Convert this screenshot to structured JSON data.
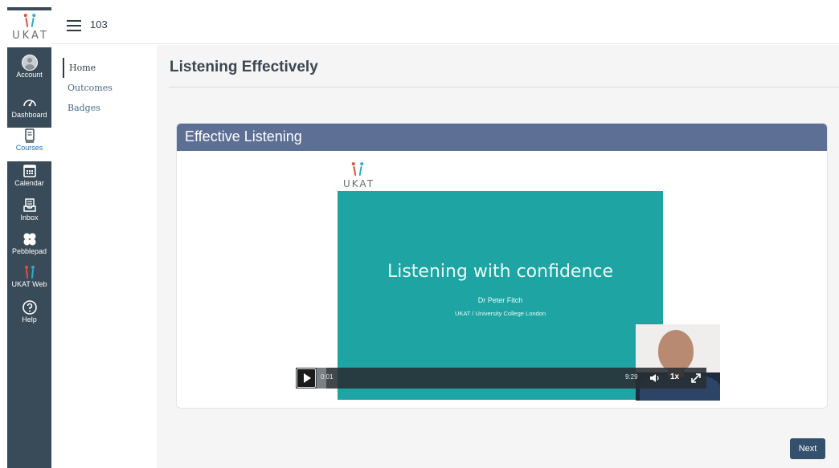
{
  "brand": {
    "logo_text": "UKAT"
  },
  "global_nav": {
    "items": [
      {
        "label": "Account",
        "icon": "avatar-icon"
      },
      {
        "label": "Dashboard",
        "icon": "dashboard-gauge-icon"
      },
      {
        "label": "Courses",
        "icon": "book-icon",
        "active": true
      },
      {
        "label": "Calendar",
        "icon": "calendar-icon"
      },
      {
        "label": "Inbox",
        "icon": "inbox-icon"
      },
      {
        "label": "Pebblepad",
        "icon": "pebblepad-icon"
      },
      {
        "label": "UKAT Web",
        "icon": "ukat-figures-icon"
      },
      {
        "label": "Help",
        "icon": "help-circle-icon"
      }
    ]
  },
  "topbar": {
    "breadcrumb": "103"
  },
  "course_nav": {
    "items": [
      "Home",
      "Outcomes",
      "Badges"
    ],
    "active": "Home"
  },
  "page": {
    "title": "Listening Effectively"
  },
  "module": {
    "header": "Effective Listening",
    "video": {
      "slide_logo": "UKAT",
      "slide_title": "Listening with confidence",
      "slide_author": "Dr Peter Fitch",
      "slide_affiliation": "UKAT / University College London",
      "current_time": "0:01",
      "duration": "9:29",
      "speed": "1x",
      "progress": 0.002
    }
  },
  "footer": {
    "next_label": "Next"
  },
  "colors": {
    "nav_bg": "#394b58",
    "card_header": "#5d6f94",
    "slide_teal": "#1ea4a2",
    "button": "#34506e"
  }
}
